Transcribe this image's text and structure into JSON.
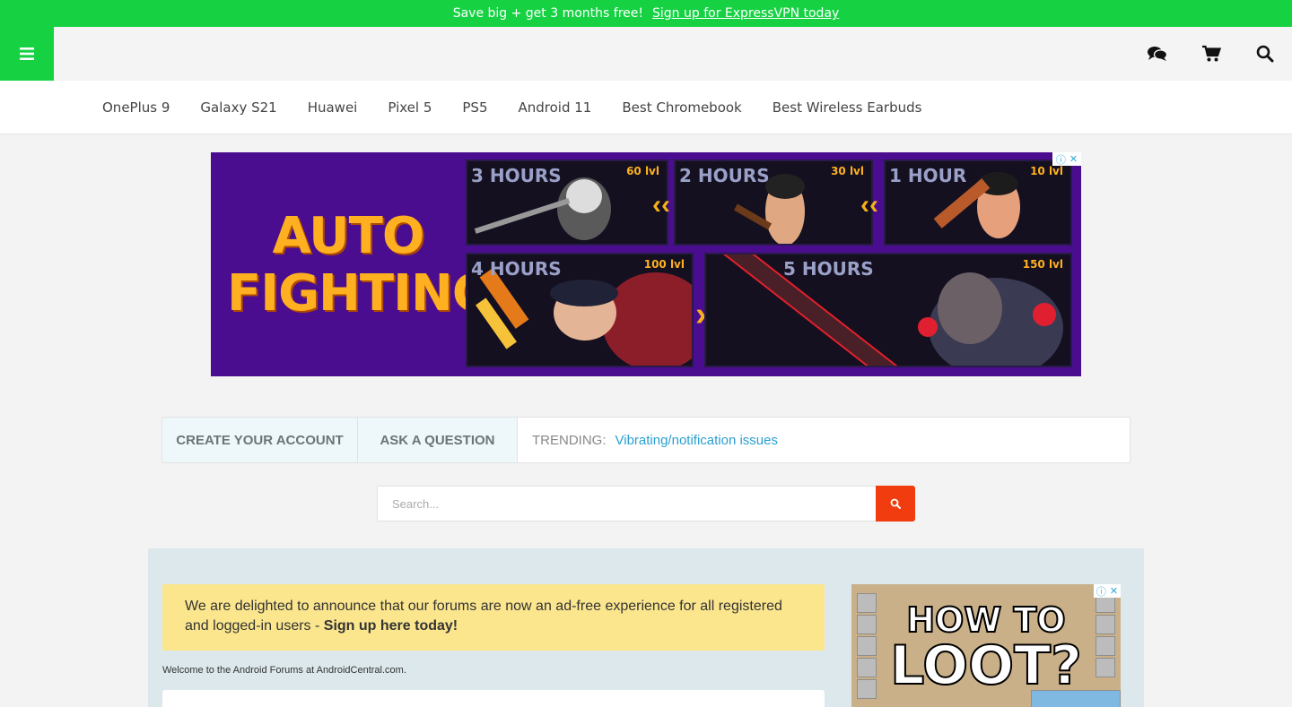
{
  "promo": {
    "text": "Save big + get 3 months free!",
    "link": "Sign up for ExpressVPN today"
  },
  "header": {
    "icons": [
      "menu-icon",
      "chat-icon",
      "cart-icon",
      "search-icon"
    ]
  },
  "topnav": {
    "items": [
      "OnePlus 9",
      "Galaxy S21",
      "Huawei",
      "Pixel 5",
      "PS5",
      "Android 11",
      "Best Chromebook",
      "Best Wireless Earbuds"
    ]
  },
  "ad_banner": {
    "title_line1": "AUTO",
    "title_line2": "FIGHTING",
    "panels": [
      {
        "hours": "3 HOURS",
        "level": "60 lvl"
      },
      {
        "hours": "2 HOURS",
        "level": "30 lvl"
      },
      {
        "hours": "1 HOUR",
        "level": "10 lvl"
      },
      {
        "hours": "4 HOURS",
        "level": "100 lvl"
      },
      {
        "hours": "5 HOURS",
        "level": "150 lvl"
      }
    ]
  },
  "actions": {
    "create_account": "CREATE YOUR ACCOUNT",
    "ask_question": "ASK A QUESTION",
    "trending_label": "TRENDING:",
    "trending_value": "Vibrating/notification issues"
  },
  "search": {
    "placeholder": "Search..."
  },
  "main": {
    "notice_text": "We are delighted to announce that our forums are now an ad-free experience for all registered and logged-in users - ",
    "notice_link": "Sign up here today!",
    "welcome": "Welcome to the Android Forums at AndroidCentral.com."
  },
  "side_ad": {
    "line1": "HOW TO",
    "line2": "LOOT?"
  },
  "colors": {
    "brand_green": "#16d243",
    "search_button": "#f03c0e",
    "trending_link": "#2a9fd0",
    "notice_bg": "#fbe68e",
    "ad_purple": "#4a0d8f"
  }
}
